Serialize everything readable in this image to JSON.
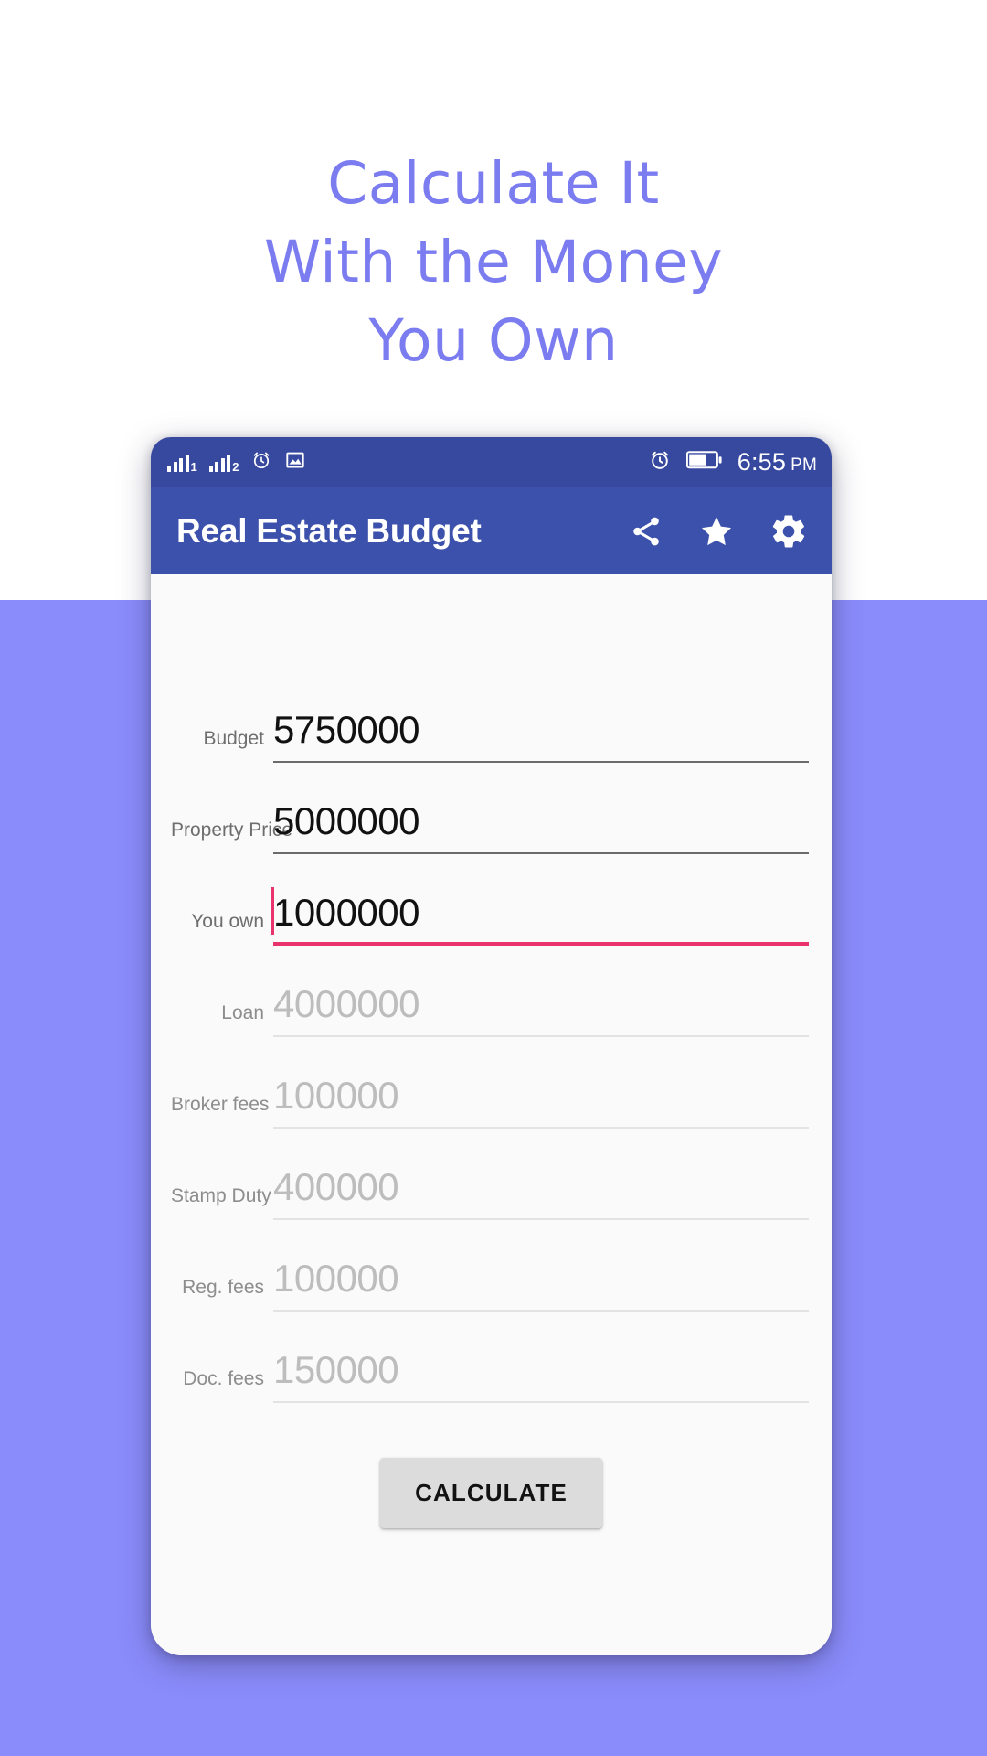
{
  "promo": {
    "headline_lines": [
      "Calculate It",
      "With the Money",
      "You Own"
    ],
    "headline_color": "#7b7cf0",
    "background_top_color": "#ffffff",
    "background_bottom_color": "#8b8cfc"
  },
  "status_bar": {
    "background_color": "#37499f",
    "left_icons": [
      {
        "name": "signal-bars-sim1-icon",
        "subscript": "1"
      },
      {
        "name": "signal-bars-sim2-icon",
        "subscript": "2"
      },
      {
        "name": "alarm-clock-icon"
      },
      {
        "name": "photo-image-icon"
      }
    ],
    "right_icons": [
      {
        "name": "alarm-clock-icon"
      },
      {
        "name": "battery-icon"
      }
    ],
    "time": "6:55",
    "am_pm": "PM"
  },
  "app_bar": {
    "title": "Real Estate Budget",
    "background_color": "#3b51ab",
    "actions": [
      {
        "name": "share-icon",
        "label": "Share"
      },
      {
        "name": "star-icon",
        "label": "Favorite"
      },
      {
        "name": "gear-icon",
        "label": "Settings"
      }
    ]
  },
  "form": {
    "fields": [
      {
        "label": "Budget",
        "value": "5750000",
        "state": "editable"
      },
      {
        "label": "Property Price",
        "value": "5000000",
        "state": "editable"
      },
      {
        "label": "You own",
        "value": "1000000",
        "state": "focused"
      },
      {
        "label": "Loan",
        "value": "4000000",
        "state": "readonly"
      },
      {
        "label": "Broker fees",
        "value": "100000",
        "state": "readonly"
      },
      {
        "label": "Stamp Duty",
        "value": "400000",
        "state": "readonly"
      },
      {
        "label": "Reg. fees",
        "value": "100000",
        "state": "readonly"
      },
      {
        "label": "Doc. fees",
        "value": "150000",
        "state": "readonly"
      }
    ],
    "focus_accent_color": "#e8336d",
    "submit_label": "CALCULATE"
  }
}
